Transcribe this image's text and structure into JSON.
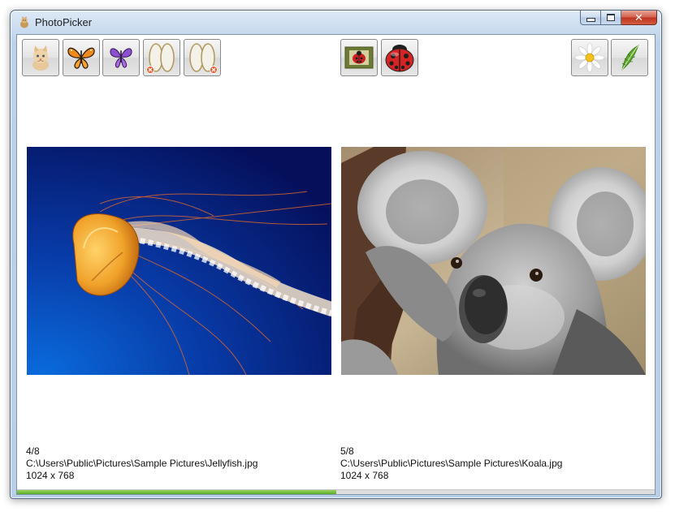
{
  "window": {
    "title": "PhotoPicker",
    "close_glyph": "✕"
  },
  "toolbar": {
    "left_buttons": [
      {
        "icon": "kitten-icon"
      },
      {
        "icon": "butterfly-orange-icon"
      },
      {
        "icon": "butterfly-purple-icon"
      },
      {
        "icon": "frame-remove-icon"
      },
      {
        "icon": "frame-remove-icon"
      }
    ],
    "center_buttons": [
      {
        "icon": "ladybug-frame-icon"
      },
      {
        "icon": "ladybug-icon"
      }
    ],
    "right_buttons": [
      {
        "icon": "daisy-icon"
      },
      {
        "icon": "feather-icon"
      }
    ]
  },
  "photos": [
    {
      "index": "4/8",
      "path": "C:\\Users\\Public\\Pictures\\Sample Pictures\\Jellyfish.jpg",
      "dimensions": "1024 x 768"
    },
    {
      "index": "5/8",
      "path": "C:\\Users\\Public\\Pictures\\Sample Pictures\\Koala.jpg",
      "dimensions": "1024 x 768"
    }
  ],
  "progress": {
    "fraction": 0.5,
    "color": "#6cbb35"
  }
}
